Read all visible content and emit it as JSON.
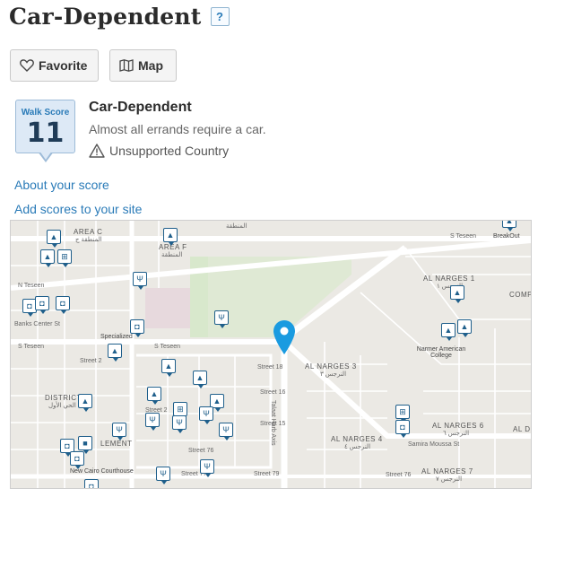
{
  "header": {
    "title": "Car-Dependent",
    "help_label": "?"
  },
  "toolbar": {
    "favorite_label": "Favorite",
    "map_label": "Map"
  },
  "score": {
    "badge_label": "Walk Score",
    "value": "11",
    "title": "Car-Dependent",
    "description": "Almost all errands require a car.",
    "unsupported": "Unsupported Country"
  },
  "links": {
    "about": "About your score",
    "add": "Add scores to your site"
  },
  "map": {
    "labels": {
      "area_c": "AREA C",
      "area_c_ar": "المنطقة ج",
      "area_f": "AREA F",
      "area_f_ar": "المنطقة",
      "al_montaza": "المنطقة",
      "s_teseen_top": "S Teseen",
      "breakout": "BreakOut",
      "n_teseen": "N Teseen",
      "banks_center": "Banks Center St",
      "s_teseen_mid": "S Teseen",
      "s_teseen_left": "S Teseen",
      "specialized": "Specialized",
      "al_narges_1": "AL NARGES 1",
      "al_narges_1_ar": "النرجس ١",
      "al_narges_3": "AL NARGES 3",
      "al_narges_3_ar": "النرجس ٣",
      "al_narges_4": "AL NARGES 4",
      "al_narges_4_ar": "النرجس ٤",
      "al_narges_6": "AL NARGES 6",
      "al_narges_6_ar": "النرجس ٦",
      "al_narges_7": "AL NARGES 7",
      "al_narges_7_ar": "النرجس ٧",
      "narmer": "Narmer American College",
      "al_di": "AL DI",
      "compo": "COMPO",
      "district": "DISTRICT",
      "district_ar": "الحي الأول",
      "lement": "LEMENT",
      "new_cairo": "New Cairo Courthouse",
      "street_2": "Street 2",
      "street_77": "Street 77",
      "street_79": "Street 79",
      "street_76": "Street 76",
      "street_76b": "Street 76",
      "street_16": "Street 16",
      "street_15": "Street 15",
      "street_18": "Street 18",
      "street_2b": "Street 2",
      "talaat_harb": "Talaat Harb Axis",
      "samira_moussa": "Samira Moussa St"
    }
  }
}
